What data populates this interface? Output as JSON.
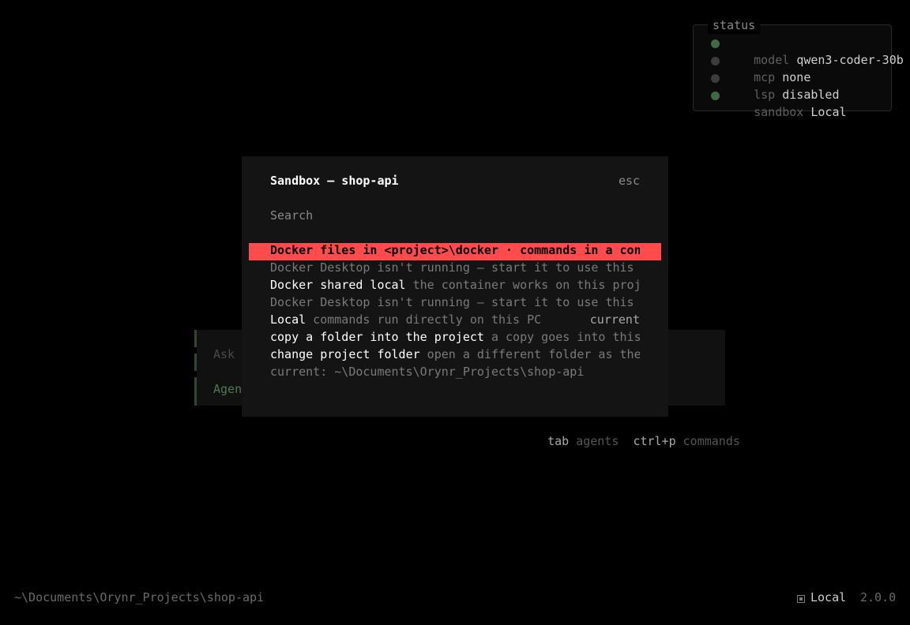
{
  "status": {
    "title": "status",
    "rows": [
      {
        "key": "model",
        "value": "qwen3-coder-30b",
        "dot_color": "#3e6b46"
      },
      {
        "key": "mcp",
        "value": "none",
        "dot_color": "#3c3c3c"
      },
      {
        "key": "lsp",
        "value": "disabled",
        "dot_color": "#3c3c3c"
      },
      {
        "key": "sandbox",
        "value": "Local",
        "dot_color": "#3e6b46"
      }
    ]
  },
  "prompt": {
    "placeholder": "Ask",
    "mode_label": "Agen"
  },
  "hints": [
    {
      "key": "tab",
      "label": "agents"
    },
    {
      "key": "ctrl+p",
      "label": "commands"
    }
  ],
  "modal": {
    "title": "Sandbox — shop-api",
    "esc": "esc",
    "search_placeholder": "Search",
    "options": [
      {
        "main": "Docker files in <project>\\docker · commands in a con",
        "desc": "",
        "selected": true
      },
      {
        "main": "",
        "desc": "Docker Desktop isn't running — start it to use this"
      },
      {
        "main": "Docker shared local",
        "desc": " the container works on this proj"
      },
      {
        "main": "",
        "desc": "Docker Desktop isn't running — start it to use this"
      },
      {
        "main": "Local",
        "desc": " commands run directly on this PC",
        "right": "current"
      },
      {
        "main": "copy a folder into the project",
        "desc": " a copy goes into this"
      },
      {
        "main": "change project folder",
        "desc": " open a different folder as the"
      },
      {
        "main": "",
        "desc": "current: ~\\Documents\\Orynr_Projects\\shop-api"
      }
    ]
  },
  "footer": {
    "path": "~\\Documents\\Orynr_Projects\\shop-api",
    "sandbox": "Local",
    "version": "2.0.0"
  }
}
